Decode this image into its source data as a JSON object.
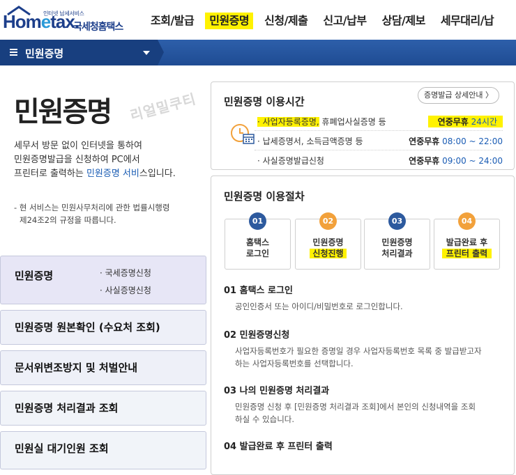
{
  "header": {
    "logo_tag": "인터넷 납세서비스",
    "logo_brand_pre": "Hom",
    "logo_brand_e": "e",
    "logo_brand_post": "tax.",
    "logo_ko": "국세청홈택스",
    "nav": [
      "조회/발급",
      "민원증명",
      "신청/제출",
      "신고/납부",
      "상담/제보",
      "세무대리/납"
    ]
  },
  "bar": {
    "title": "민원증명"
  },
  "left": {
    "page_title": "민원증명",
    "watermark": "리얼밀쿠티",
    "desc_1": "세무서 방문 없이 인터넷을 통하여",
    "desc_2": "민원증명발급을 신청하여 PC에서",
    "desc_3a": "프린터로 출력하는 ",
    "desc_3b": "민원증명 서비",
    "desc_3c": "스입니다.",
    "notice_1": "- 현 서비스는 민원사무처리에 관한 법률시행령",
    "notice_2": "  제24조2의 규정을 따릅니다.",
    "menu": [
      {
        "label": "민원증명",
        "subs": [
          "· 국세증명신청",
          "· 사실증명신청"
        ]
      },
      {
        "label": "민원증명 원본확인 (수요처 조회)"
      },
      {
        "label": "문서위변조방지 및 처벌안내"
      },
      {
        "label": "민원증명 처리결과 조회"
      },
      {
        "label": "민원실 대기인원 조회"
      }
    ]
  },
  "hours": {
    "title": "민원증명 이용시간",
    "btn": "증명발급 상세안내 〉",
    "rows": [
      {
        "l_hl": "· 사업자등록증명,",
        "l_rest": " 휴폐업사실증명 등",
        "r_k": "연중무휴",
        "r_v": " 24시간"
      },
      {
        "l": "· 납세증명서, 소득금액증명 등",
        "r_k": "연중무휴",
        "r_v": " 08:00 ~ 22:00"
      },
      {
        "l": "· 사실증명발급신청",
        "r_k": "연중무휴",
        "r_v": " 09:00 ~ 24:00"
      }
    ]
  },
  "proc": {
    "title": "민원증명 이용절차",
    "steps": [
      {
        "n": "01",
        "a": "홈택스",
        "b": "로그인"
      },
      {
        "n": "02",
        "a": "민원증명",
        "b": "신청진행"
      },
      {
        "n": "03",
        "a": "민원증명",
        "b": "처리결과"
      },
      {
        "n": "04",
        "a": "발급완료 후",
        "b": "프린터 출력"
      }
    ],
    "details": [
      {
        "t": "01 홈택스 로그인",
        "d1": "공인인증서 또는 아이디/비밀번호로 로그인합니다.",
        "d2": ""
      },
      {
        "t": "02 민원증명신청",
        "d1": "사업자등록번호가 필요한 증명일 경우 사업자등록번호 목록 중 발급받고자",
        "d2": "하는 사업자등록번호를 선택합니다."
      },
      {
        "t": "03 나의 민원증명 처리결과",
        "d1": "민원증명 신청 후 [민원증명 처리결과 조회]에서 본인의 신청내역을 조회",
        "d2": "하실 수 있습니다."
      },
      {
        "t": "04 발급완료 후 프린터 출력",
        "d1": "",
        "d2": ""
      }
    ]
  },
  "colors": {
    "navy": "#1f4c93",
    "highlight": "#fff200",
    "step_navy": "#2d5a9e",
    "step_orange": "#f2a13b"
  }
}
